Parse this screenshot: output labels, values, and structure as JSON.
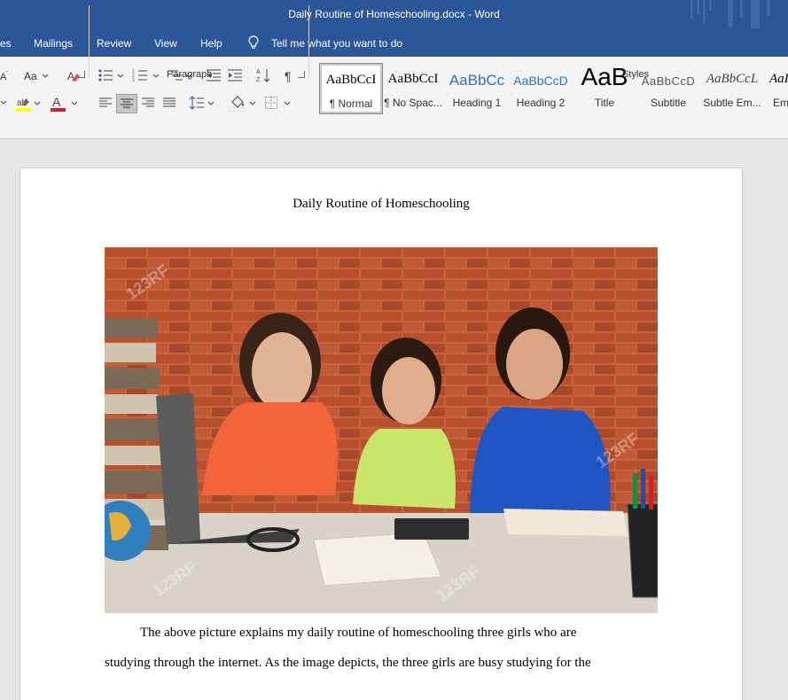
{
  "window": {
    "title": "Daily Routine of Homeschooling.docx  -  Word"
  },
  "menu": {
    "tabs": [
      "es",
      "Mailings",
      "Review",
      "View",
      "Help"
    ],
    "tell_me": "Tell me what you want to do"
  },
  "ribbon": {
    "font_case_label": "Aa",
    "paragraph_label": "Paragraph",
    "styles_label": "Styles",
    "styles": [
      {
        "sample": "AaBbCcI",
        "name": "¶ Normal"
      },
      {
        "sample": "AaBbCcI",
        "name": "¶ No Spac..."
      },
      {
        "sample": "AaBbCc",
        "name": "Heading 1"
      },
      {
        "sample": "AaBbCcD",
        "name": "Heading 2"
      },
      {
        "sample": "AaB",
        "name": "Title"
      },
      {
        "sample": "AaBbCcD",
        "name": "Subtitle"
      },
      {
        "sample": "AaBbCcL",
        "name": "Subtle Em..."
      },
      {
        "sample": "AaI",
        "name": "Em"
      }
    ]
  },
  "document": {
    "title": "Daily Routine of Homeschooling",
    "lines": [
      "The above picture explains my daily routine of homeschooling three girls who are",
      "studying through the internet. As the image depicts, the three girls are busy studying for the"
    ],
    "watermark_text": "123RF"
  },
  "colors": {
    "titlebar": "#2b579a",
    "ribbon": "#f3f3f3",
    "canvas": "#e6e6e6"
  }
}
